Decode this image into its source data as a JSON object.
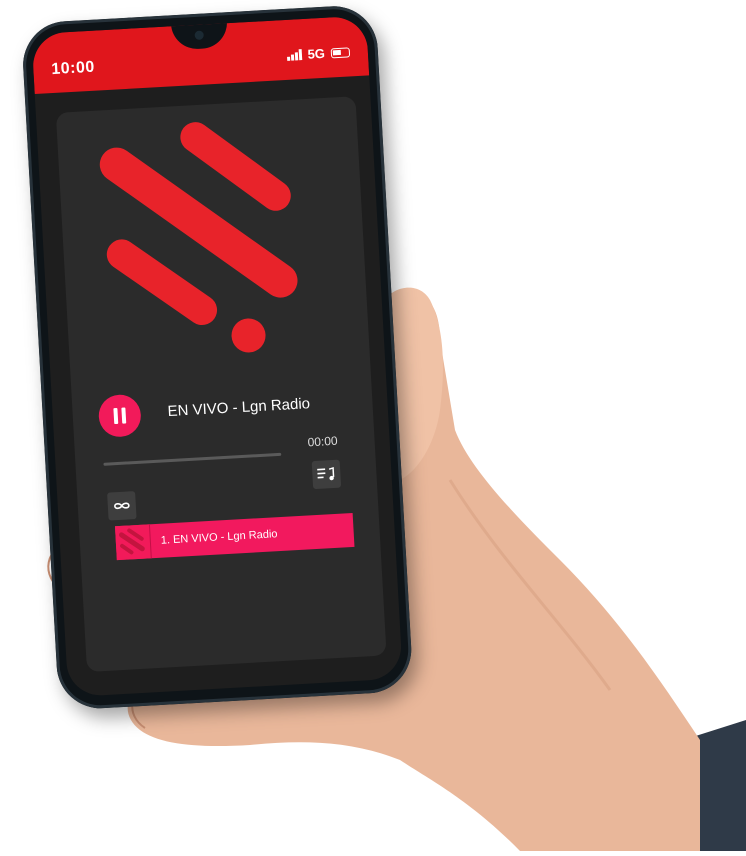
{
  "status_bar": {
    "time": "10:00",
    "network": "5G",
    "color": "#e0161c"
  },
  "player": {
    "track_title": "EN VIVO - Lgn Radio",
    "time": "00:00",
    "progress": 0,
    "accent": "#f21a5a",
    "icons": {
      "pause": "pause-icon",
      "loop": "infinity-icon",
      "playlist": "playlist-music-icon"
    }
  },
  "playlist": {
    "items": [
      {
        "label": "1. EN VIVO - Lgn Radio"
      }
    ]
  }
}
